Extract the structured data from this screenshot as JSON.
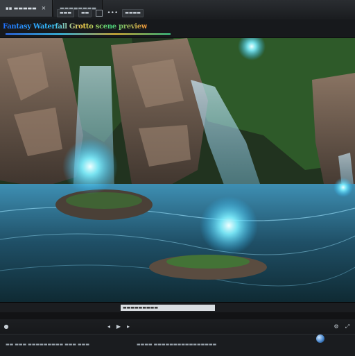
{
  "tabs": [
    {
      "label": "▪▪ ▬▬▬▬▬"
    },
    {
      "label": "▬▬▬▬▬▬▬▬"
    }
  ],
  "toolbar": {
    "items": [
      "▬▬▬",
      "▬▬",
      "▬▬▬▬"
    ]
  },
  "window_title": "Fantasy Waterfall Grotto scene preview",
  "timeline": {
    "scrubber_label": "▬▬▬▬▬▬▬▬▬"
  },
  "status": {
    "left_text": "▬▬ ▬▬▬ ▬▬▬▬▬▬▬▬▬ ▬▬▬ ▬▬▬",
    "mid_text": "▬▬▬▬ ▬▬▬▬▬▬▬▬▬▬▬▬▬▬▬▬"
  },
  "colors": {
    "accent": "#3fd1ff",
    "glow": "#8ff6ff",
    "water": "#2b6a86",
    "rock": "#6b5a4c",
    "foliage": "#2f6a2c"
  }
}
